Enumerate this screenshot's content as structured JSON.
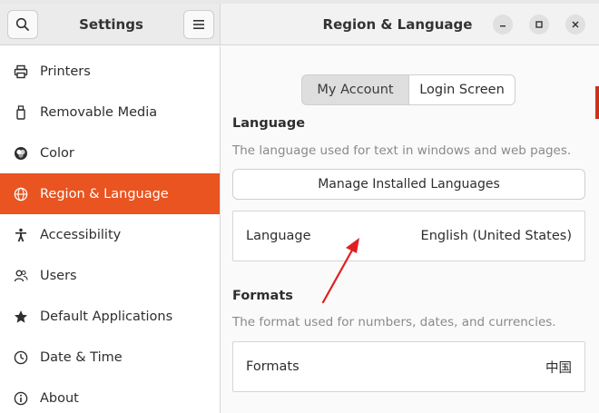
{
  "header": {
    "left_title": "Settings",
    "right_title": "Region & Language",
    "search_icon": "search-icon",
    "menu_icon": "hamburger-menu-icon",
    "window_controls": [
      "minimize-icon",
      "maximize-icon",
      "close-icon"
    ]
  },
  "sidebar": {
    "items": [
      {
        "label": "Printers",
        "icon": "printer-icon"
      },
      {
        "label": "Removable Media",
        "icon": "usb-drive-icon"
      },
      {
        "label": "Color",
        "icon": "color-icon"
      },
      {
        "label": "Region & Language",
        "icon": "globe-icon",
        "active": true
      },
      {
        "label": "Accessibility",
        "icon": "accessibility-icon"
      },
      {
        "label": "Users",
        "icon": "users-icon"
      },
      {
        "label": "Default Applications",
        "icon": "star-icon"
      },
      {
        "label": "Date & Time",
        "icon": "clock-icon"
      },
      {
        "label": "About",
        "icon": "info-icon"
      }
    ]
  },
  "content": {
    "tabs": [
      {
        "label": "My Account",
        "selected": true
      },
      {
        "label": "Login Screen",
        "selected": false
      }
    ],
    "language_section": {
      "title": "Language",
      "description": "The language used for text in windows and web pages.",
      "manage_button": "Manage Installed Languages",
      "row_label": "Language",
      "row_value": "English (United States)"
    },
    "formats_section": {
      "title": "Formats",
      "description": "The format used for numbers, dates, and currencies.",
      "row_label": "Formats",
      "row_value": "中国"
    }
  },
  "colors": {
    "accent": "#e95420",
    "annotation_arrow": "#e02020"
  }
}
